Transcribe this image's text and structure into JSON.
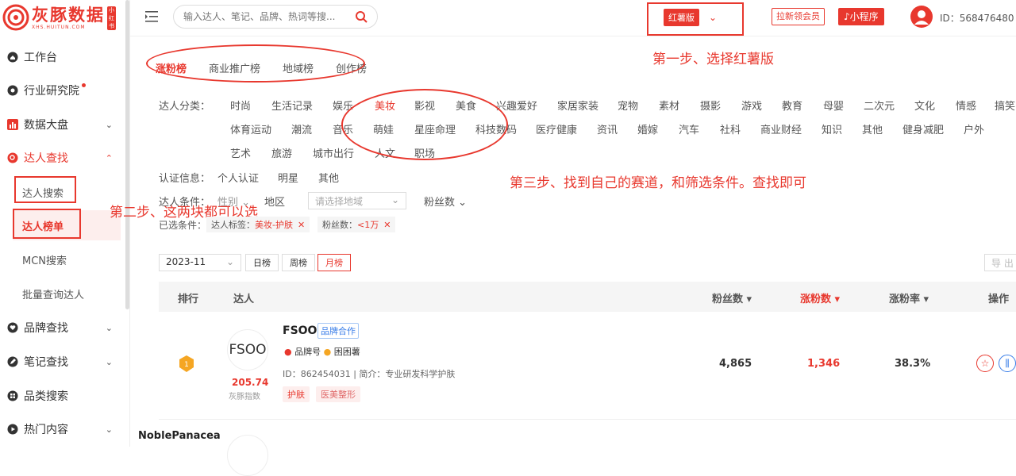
{
  "brand": {
    "name": "灰豚数据",
    "sub": "XHS.HUITUN.COM",
    "badge": "小红书"
  },
  "sidebar": {
    "items": [
      {
        "label": "工作台"
      },
      {
        "label": "行业研究院"
      },
      {
        "label": "数据大盘"
      },
      {
        "label": "达人查找"
      },
      {
        "label": "品牌查找"
      },
      {
        "label": "笔记查找"
      },
      {
        "label": "品类搜索"
      },
      {
        "label": "热门内容"
      }
    ],
    "subitems": [
      {
        "label": "达人搜索"
      },
      {
        "label": "达人榜单"
      },
      {
        "label": "MCN搜索"
      },
      {
        "label": "批量查询达人"
      }
    ]
  },
  "topbar": {
    "search_placeholder": "输入达人、笔记、品牌、热词等搜...",
    "version": "红薯版",
    "promo": "拉新领会员",
    "mini": "小程序",
    "uid": "ID：568476480"
  },
  "tabs": [
    "涨粉榜",
    "商业推广榜",
    "地域榜",
    "创作榜"
  ],
  "filters": {
    "category_label": "达人分类：",
    "categories_row1": [
      "时尚",
      "生活记录",
      "娱乐",
      "美妆",
      "影视",
      "美食",
      "兴趣爱好",
      "家居家装",
      "宠物",
      "素材",
      "摄影",
      "游戏",
      "教育",
      "母婴",
      "二次元",
      "文化",
      "情感",
      "搞笑"
    ],
    "categories_row2": [
      "体育运动",
      "潮流",
      "音乐",
      "萌娃",
      "星座命理",
      "科技数码",
      "医疗健康",
      "资讯",
      "婚嫁",
      "汽车",
      "社科",
      "商业财经",
      "知识",
      "其他",
      "健身减肥",
      "户外"
    ],
    "categories_row3": [
      "艺术",
      "旅游",
      "城市出行",
      "人文",
      "职场"
    ],
    "cert_label": "认证信息：",
    "cert_options": [
      "个人认证",
      "明星",
      "其他"
    ],
    "cond_label": "达人条件：",
    "cond_gender": "性别",
    "cond_region": "地区",
    "region_placeholder": "请选择地域",
    "cond_fans": "粉丝数",
    "selected_label": "已选条件：",
    "chip1_key": "达人标签：",
    "chip1_val": "美妆-护肤",
    "chip2_key": "粉丝数：",
    "chip2_val": "<1万"
  },
  "annotations": {
    "step1": "第一步、选择红薯版",
    "step2": "第二步、这两块都可以选",
    "step3": "第三步、找到自己的赛道，和筛选条件。查找即可"
  },
  "ranking": {
    "date": "2023-11",
    "periods": [
      "日榜",
      "周榜",
      "月榜"
    ],
    "export": "导 出",
    "headers": {
      "rank": "排行",
      "kol": "达人",
      "fans": "粉丝数 ▾",
      "growth": "涨粉数 ▾",
      "rate": "涨粉率 ▾",
      "ops": "操作"
    }
  },
  "rows": [
    {
      "name": "FSOO",
      "logo_text": "FSOO",
      "tag": "品牌合作",
      "meta1": "品牌号",
      "meta2": "困困薯",
      "id_line": "ID：862454031 | 简介：专业研发科学护肤",
      "score": "205.74",
      "score_label": "灰豚指数",
      "tags": [
        "护肤",
        "医美整形"
      ],
      "fans": "4,865",
      "growth": "1,346",
      "rate": "38.3%"
    },
    {
      "name": "NoblePanacea"
    }
  ]
}
